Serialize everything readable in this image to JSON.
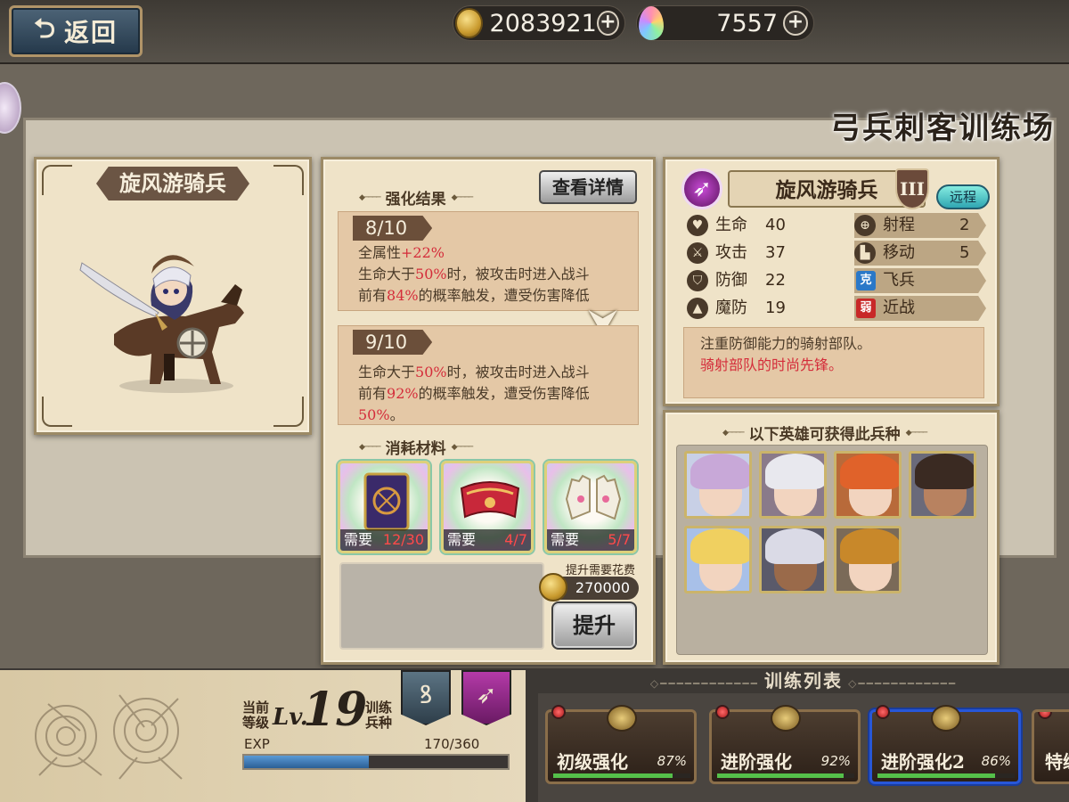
{
  "top": {
    "back_label": "返回",
    "gold": "2083921",
    "gems": "7557"
  },
  "page_title": "弓兵刺客训练场",
  "unit": {
    "name": "旋风游骑兵"
  },
  "enhance": {
    "detail_button": "查看详情",
    "results_heading": "强化结果",
    "current": {
      "level": "8/10",
      "line1_prefix": "全属性",
      "line1_value": "+22%",
      "line2_prefix": "生命大于",
      "line2_value": "50%",
      "line2_suffix": "时，被攻击时进入战斗",
      "line3_prefix": "前有",
      "line3_value": "84%",
      "line3_suffix": "的概率触发，遭受伤害降低"
    },
    "next": {
      "level": "9/10",
      "line2_prefix": "生命大于",
      "line2_value": "50%",
      "line2_suffix": "时，被攻击时进入战斗",
      "line3_prefix": "前有",
      "line3_value": "92%",
      "line3_suffix": "的概率触发，遭受伤害降低",
      "line4_value": "50%",
      "line4_suffix": "。"
    },
    "materials_heading": "消耗材料",
    "materials": [
      {
        "need_label": "需要",
        "count": "12/30",
        "icon": "tome-icon"
      },
      {
        "need_label": "需要",
        "count": "4/7",
        "icon": "scarf-icon"
      },
      {
        "need_label": "需要",
        "count": "5/7",
        "icon": "gloves-icon"
      }
    ],
    "cost_label": "提升需要花费",
    "cost_value": "270000",
    "upgrade_button": "提升"
  },
  "info": {
    "name": "旋风游骑兵",
    "tier": "III",
    "range_badge": "远程",
    "stats_left": [
      {
        "icon": "heart-icon",
        "label": "生命",
        "value": "40"
      },
      {
        "icon": "sword-icon",
        "label": "攻击",
        "value": "37"
      },
      {
        "icon": "shield-icon",
        "label": "防御",
        "value": "22"
      },
      {
        "icon": "magic-icon",
        "label": "魔防",
        "value": "19"
      }
    ],
    "stats_right": [
      {
        "icon": "crosshair-icon",
        "label": "射程",
        "value": "2"
      },
      {
        "icon": "boot-icon",
        "label": "移动",
        "value": "5"
      },
      {
        "icon": "counter-badge",
        "badge": "克",
        "label": "飞兵"
      },
      {
        "icon": "weak-badge",
        "badge": "弱",
        "label": "近战"
      }
    ],
    "desc_line1": "注重防御能力的骑射部队。",
    "desc_line2": "骑射部队的时尚先锋。"
  },
  "heroes": {
    "heading": "以下英雄可获得此兵种",
    "count": 7
  },
  "level": {
    "label_current": "当前",
    "label_level": "等级",
    "lv_prefix": "Lv.",
    "value": "19",
    "label_train": "训练",
    "label_type": "兵种",
    "exp_label": "EXP",
    "exp_value": "170/360",
    "exp_fraction": 0.472
  },
  "training_list": {
    "title": "训练列表",
    "items": [
      {
        "name": "初级强化",
        "pct": "87%",
        "fraction": 0.87
      },
      {
        "name": "进阶强化",
        "pct": "92%",
        "fraction": 0.92
      },
      {
        "name": "进阶强化2",
        "pct": "86%",
        "fraction": 0.86
      },
      {
        "name": "特练"
      }
    ]
  },
  "colors": {
    "accent_red": "#d42c3a",
    "selected_border": "#2757d8",
    "exp_bar": "#3a7fc4"
  }
}
